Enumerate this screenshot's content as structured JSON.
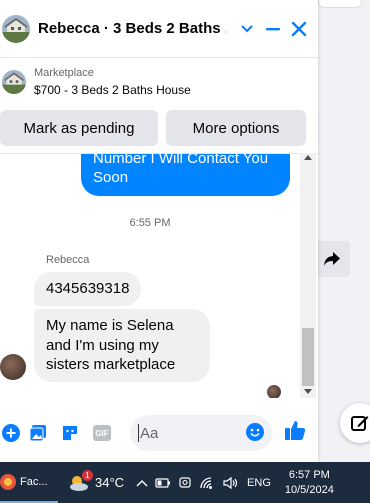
{
  "chat_window": {
    "title": "Rebecca · 3 Beds 2 Baths ...",
    "marketplace_label": "Marketplace",
    "listing": "$700 - 3 Beds 2 Baths House",
    "mark_pending_label": "Mark as pending",
    "more_options_label": "More options"
  },
  "messages": {
    "outgoing_partial": "Number I Will Contact You Soon",
    "time_separator": "6:55 PM",
    "sender_name": "Rebecca",
    "incoming": [
      "4345639318",
      "My name is Selena and I'm using my sisters marketplace"
    ]
  },
  "composer": {
    "placeholder": "Aa",
    "gif_label": "GIF"
  },
  "taskbar": {
    "app_label": "Fac...",
    "weather_badge": "1",
    "temperature": "34°C",
    "language": "ENG",
    "time": "6:57 PM",
    "date": "10/5/2024"
  },
  "colors": {
    "accent": "#0084ff",
    "messenger_blue": "#0a7cff",
    "taskbar": "#1c2b3d"
  }
}
